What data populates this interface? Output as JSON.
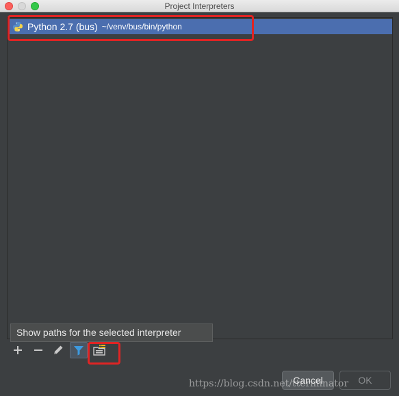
{
  "window": {
    "title": "Project Interpreters"
  },
  "interpreters": [
    {
      "name": "Python 2.7 (bus)",
      "path": "~/venv/bus/bin/python",
      "selected": true,
      "icon": "python-icon"
    }
  ],
  "tooltip": {
    "text": "Show paths for the selected interpreter"
  },
  "toolbar": {
    "add_icon": "plus-icon",
    "remove_icon": "minus-icon",
    "edit_icon": "pencil-icon",
    "filter_icon": "filter-icon",
    "paths_icon": "show-paths-icon"
  },
  "buttons": {
    "cancel": "Cancel",
    "ok": "OK"
  },
  "watermark": "https://blog.csdn.net/tterminator",
  "colors": {
    "selection": "#4b6eaf",
    "highlight_box": "#e02424",
    "background": "#3c3f41"
  }
}
